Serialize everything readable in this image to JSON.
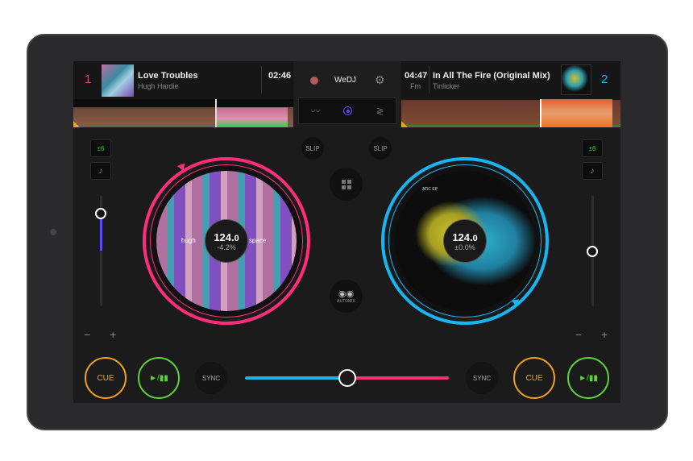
{
  "app": {
    "name": "WeDJ"
  },
  "deck1": {
    "number": "1",
    "title": "Love Troubles",
    "artist": "Hugh Hardie",
    "time": "02:46",
    "bpm_int": "124.",
    "bpm_dec": "0",
    "pitch": "-4.2%",
    "label_left": "hugh",
    "label_right": "space",
    "key_lock": "±6",
    "pitch_position": 0.16,
    "color": "#ff2d7a"
  },
  "deck2": {
    "number": "2",
    "title": "In All The Fire (Original Mix)",
    "artist": "Tinlicker",
    "time": "04:47",
    "key": "Fm",
    "bpm_int": "124.",
    "bpm_dec": "0",
    "pitch": "±0.0%",
    "cover_text": "ATIC EP",
    "key_lock": "±6",
    "pitch_position": 0.5,
    "color": "#1ab4f0"
  },
  "center": {
    "views": [
      "waveform-icon",
      "platter-icon",
      "vertical-waveform-icon"
    ],
    "slip": "SLIP",
    "automix": "AUTOMIX"
  },
  "controls": {
    "cue": "CUE",
    "play": "►/▮▮",
    "sync": "SYNC",
    "minus": "−",
    "plus": "+",
    "crossfader_position": 0.5
  },
  "colors": {
    "cue": "#f0a21c",
    "play": "#5fd33a",
    "accent": "#5b4ef0"
  }
}
